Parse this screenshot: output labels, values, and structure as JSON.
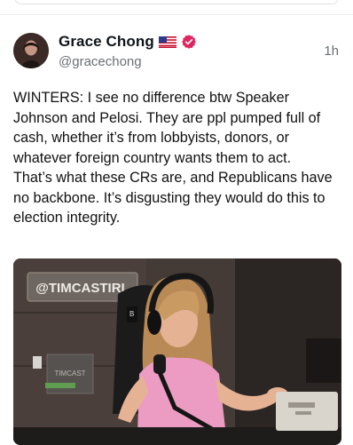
{
  "post": {
    "author": {
      "display_name": "Grace Chong",
      "handle": "@gracechong",
      "flag_icon": "us-flag-icon",
      "verified_icon": "verified-badge-icon"
    },
    "timestamp": "1h",
    "text": "WINTERS: I see no difference btw Speaker Johnson and Pelosi. They are ppl pumped full of cash, whether it’s from lobbyists, donors, or whatever foreign country wants them to act. That’s what these CRs are, and Republicans have no backbone. It’s disgusting they would do this to election integrity.",
    "media": {
      "type": "video-still",
      "sign_text": "@TIMCASTIRL",
      "box_text": "TIMCAST"
    }
  },
  "colors": {
    "text": "#0f1419",
    "muted": "#6b6f73",
    "verified": "#e0245e"
  }
}
